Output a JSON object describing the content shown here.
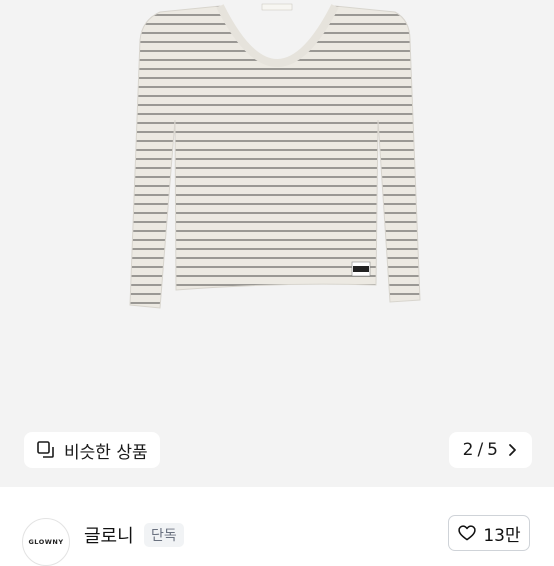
{
  "product_image": {
    "label_tag": "GLOWNY",
    "neck_tag": "GLOWNY"
  },
  "similar_button": {
    "icon": "similar-items-icon",
    "label": "비슷한 상품"
  },
  "pager": {
    "current": "2",
    "separator": "/",
    "total": "5",
    "icon": "chevron-right-icon"
  },
  "seller": {
    "avatar_text": "GLOWNY",
    "name": "글로니",
    "badge": "단독"
  },
  "like_button": {
    "icon": "heart-outline-icon",
    "count": "13만"
  }
}
